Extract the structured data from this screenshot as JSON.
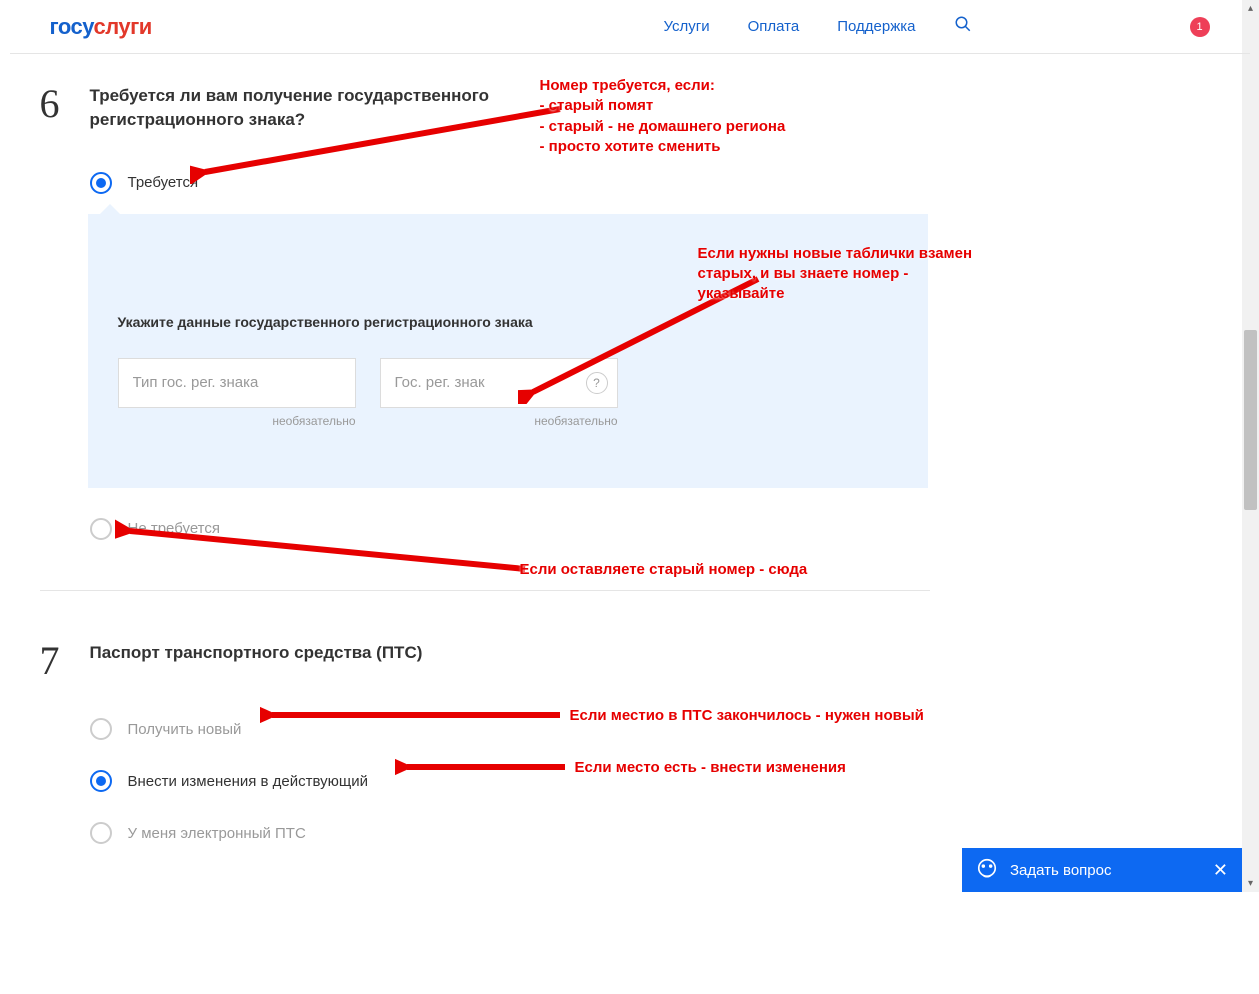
{
  "header": {
    "logo_part1": "госу",
    "logo_part2": "слуги",
    "nav": {
      "services": "Услуги",
      "payment": "Оплата",
      "support": "Поддержка"
    },
    "badge_count": "1"
  },
  "section6": {
    "number": "6",
    "title": "Требуется ли вам получение государственного регистрационного знака?",
    "option_required": "Требуется",
    "option_not_required": "Не требуется",
    "panel": {
      "title": "Укажите данные государственного регистрационного знака",
      "field1_placeholder": "Тип гос. рег. знака",
      "field2_placeholder": "Гос. рег. знак",
      "optional_label": "необязательно",
      "help": "?"
    }
  },
  "section7": {
    "number": "7",
    "title": "Паспорт транспортного средства (ПТС)",
    "option_new": "Получить новый",
    "option_change": "Внести изменения в действующий",
    "option_electronic": "У меня электронный ПТС"
  },
  "annotations": {
    "ann1": "Номер требуется, если:\n- старый помят\n- старый - не домашнего региона\n- просто хотите сменить",
    "ann2": "Если нужны новые таблички взамен старых, и вы знаете номер - указывайте",
    "ann3": "Если оставляете старый номер - сюда",
    "ann4": "Если местио в ПТС закончилось - нужен новый",
    "ann5": "Если место есть - внести изменения"
  },
  "chat": {
    "label": "Задать вопрос"
  }
}
